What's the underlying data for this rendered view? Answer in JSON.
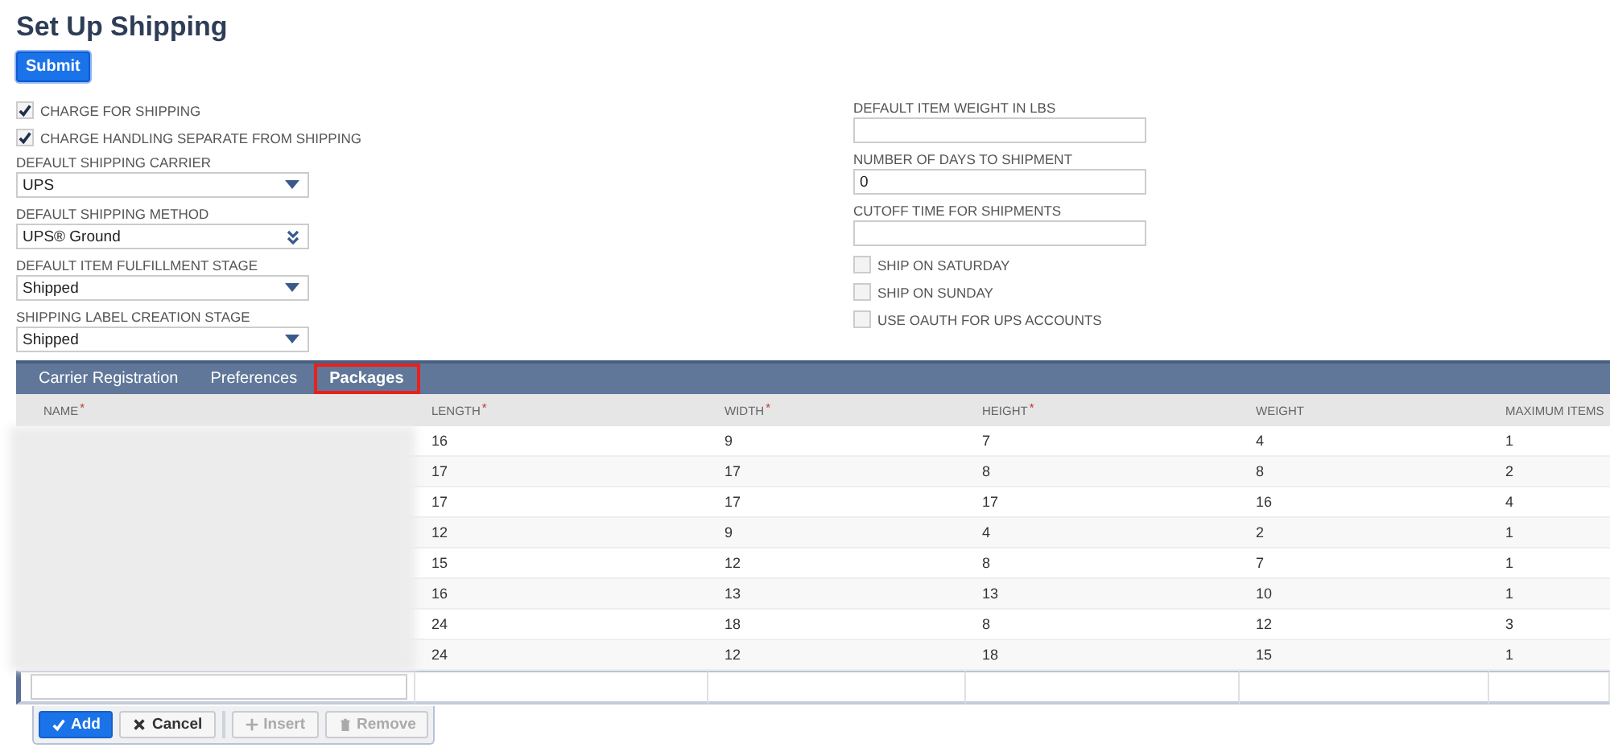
{
  "page": {
    "title": "Set Up Shipping",
    "submit": "Submit"
  },
  "left_fields": [
    {
      "kind": "checkbox",
      "label": "CHARGE FOR SHIPPING",
      "checked": true
    },
    {
      "kind": "checkbox",
      "label": "CHARGE HANDLING SEPARATE FROM SHIPPING",
      "checked": true
    },
    {
      "kind": "dropdown",
      "label": "DEFAULT SHIPPING CARRIER",
      "value": "UPS"
    },
    {
      "kind": "popup",
      "label": "DEFAULT SHIPPING METHOD",
      "value": "UPS® Ground"
    },
    {
      "kind": "dropdown",
      "label": "DEFAULT ITEM FULFILLMENT STAGE",
      "value": "Shipped"
    },
    {
      "kind": "dropdown",
      "label": "SHIPPING LABEL CREATION STAGE",
      "value": "Shipped"
    }
  ],
  "right_fields": [
    {
      "kind": "text",
      "label": "DEFAULT ITEM WEIGHT IN LBS"
    },
    {
      "kind": "text",
      "label": "NUMBER OF DAYS TO SHIPMENT",
      "value": "0"
    },
    {
      "kind": "text",
      "label": "CUTOFF TIME FOR SHIPMENTS"
    },
    {
      "kind": "checkbox",
      "label": "SHIP ON SATURDAY",
      "checked": false
    },
    {
      "kind": "checkbox",
      "label": "SHIP ON SUNDAY",
      "checked": false
    },
    {
      "kind": "checkbox",
      "label": "USE OAUTH FOR UPS ACCOUNTS",
      "checked": false
    }
  ],
  "tabs": [
    {
      "label": "Carrier Registration",
      "selected": false,
      "highlighted": false
    },
    {
      "label": "Preferences",
      "selected": false,
      "highlighted": false
    },
    {
      "label": "Packages",
      "selected": true,
      "highlighted": true
    }
  ],
  "table": {
    "columns": [
      {
        "label": "NAME",
        "marker": "*"
      },
      {
        "label": "LENGTH",
        "marker": "*"
      },
      {
        "label": "WIDTH",
        "marker": "*"
      },
      {
        "label": "HEIGHT",
        "marker": "*"
      },
      {
        "label": "WEIGHT"
      },
      {
        "label": "MAXIMUM ITEMS"
      }
    ],
    "rows": [
      [
        "",
        "16",
        "9",
        "7",
        "4",
        "1"
      ],
      [
        "",
        "17",
        "17",
        "8",
        "8",
        "2"
      ],
      [
        "",
        "17",
        "17",
        "17",
        "16",
        "4"
      ],
      [
        "",
        "12",
        "9",
        "4",
        "2",
        "1"
      ],
      [
        "",
        "15",
        "12",
        "8",
        "7",
        "1"
      ],
      [
        "",
        "16",
        "13",
        "13",
        "10",
        "1"
      ],
      [
        "",
        "24",
        "18",
        "8",
        "12",
        "3"
      ],
      [
        "",
        "24",
        "12",
        "18",
        "15",
        "1"
      ]
    ],
    "buttons": [
      {
        "kind": "primary",
        "label": "Add",
        "disabled": false
      },
      {
        "kind": "cancel",
        "label": "Cancel",
        "disabled": false
      },
      {
        "kind": "insert",
        "label": "Insert",
        "disabled": true
      },
      {
        "kind": "remove",
        "label": "Remove",
        "disabled": true
      }
    ]
  }
}
